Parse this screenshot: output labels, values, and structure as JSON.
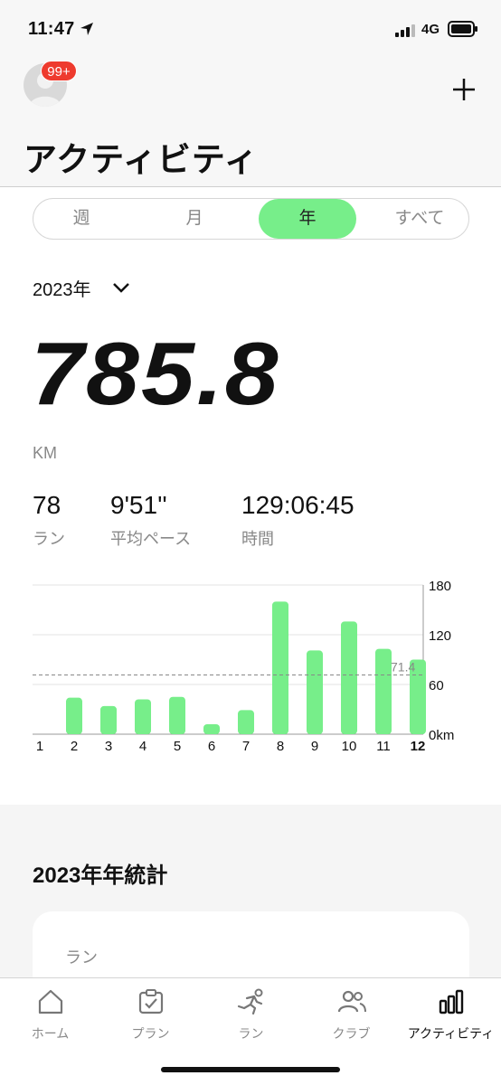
{
  "status_bar": {
    "time": "11:47",
    "network": "4G"
  },
  "header": {
    "badge": "99+",
    "title": "アクティビティ"
  },
  "period_tabs": [
    {
      "label": "週",
      "active": false
    },
    {
      "label": "月",
      "active": false
    },
    {
      "label": "年",
      "active": true
    },
    {
      "label": "すべて",
      "active": false
    }
  ],
  "year_selector": {
    "label": "2023年"
  },
  "summary": {
    "distance": "785.8",
    "unit": "KM",
    "stats": [
      {
        "value": "78",
        "label": "ラン"
      },
      {
        "value": "9'51''",
        "label": "平均ペース"
      },
      {
        "value": "129:06:45",
        "label": "時間"
      }
    ]
  },
  "chart_data": {
    "type": "bar",
    "categories": [
      "1",
      "2",
      "3",
      "4",
      "5",
      "6",
      "7",
      "8",
      "9",
      "10",
      "11",
      "12"
    ],
    "values": [
      0,
      44,
      34,
      42,
      45,
      12,
      29,
      160,
      101,
      136,
      103,
      90
    ],
    "ylim": [
      0,
      180
    ],
    "yticks": [
      "0km",
      "60",
      "120",
      "180"
    ],
    "average": 71.4,
    "average_label": "71.4",
    "highlight_category": "12",
    "bar_color": "#77ee8a",
    "grid": true
  },
  "annual_stats": {
    "title": "2023年年統計",
    "card_label": "ラン"
  },
  "tab_bar": [
    {
      "icon": "home-icon",
      "label": "ホーム",
      "active": false
    },
    {
      "icon": "plan-icon",
      "label": "プラン",
      "active": false
    },
    {
      "icon": "run-icon",
      "label": "ラン",
      "active": false
    },
    {
      "icon": "club-icon",
      "label": "クラブ",
      "active": false
    },
    {
      "icon": "activity-icon",
      "label": "アクティビティ",
      "active": true
    }
  ],
  "colors": {
    "accent": "#77ee8a",
    "badge": "#ee3b2e"
  }
}
